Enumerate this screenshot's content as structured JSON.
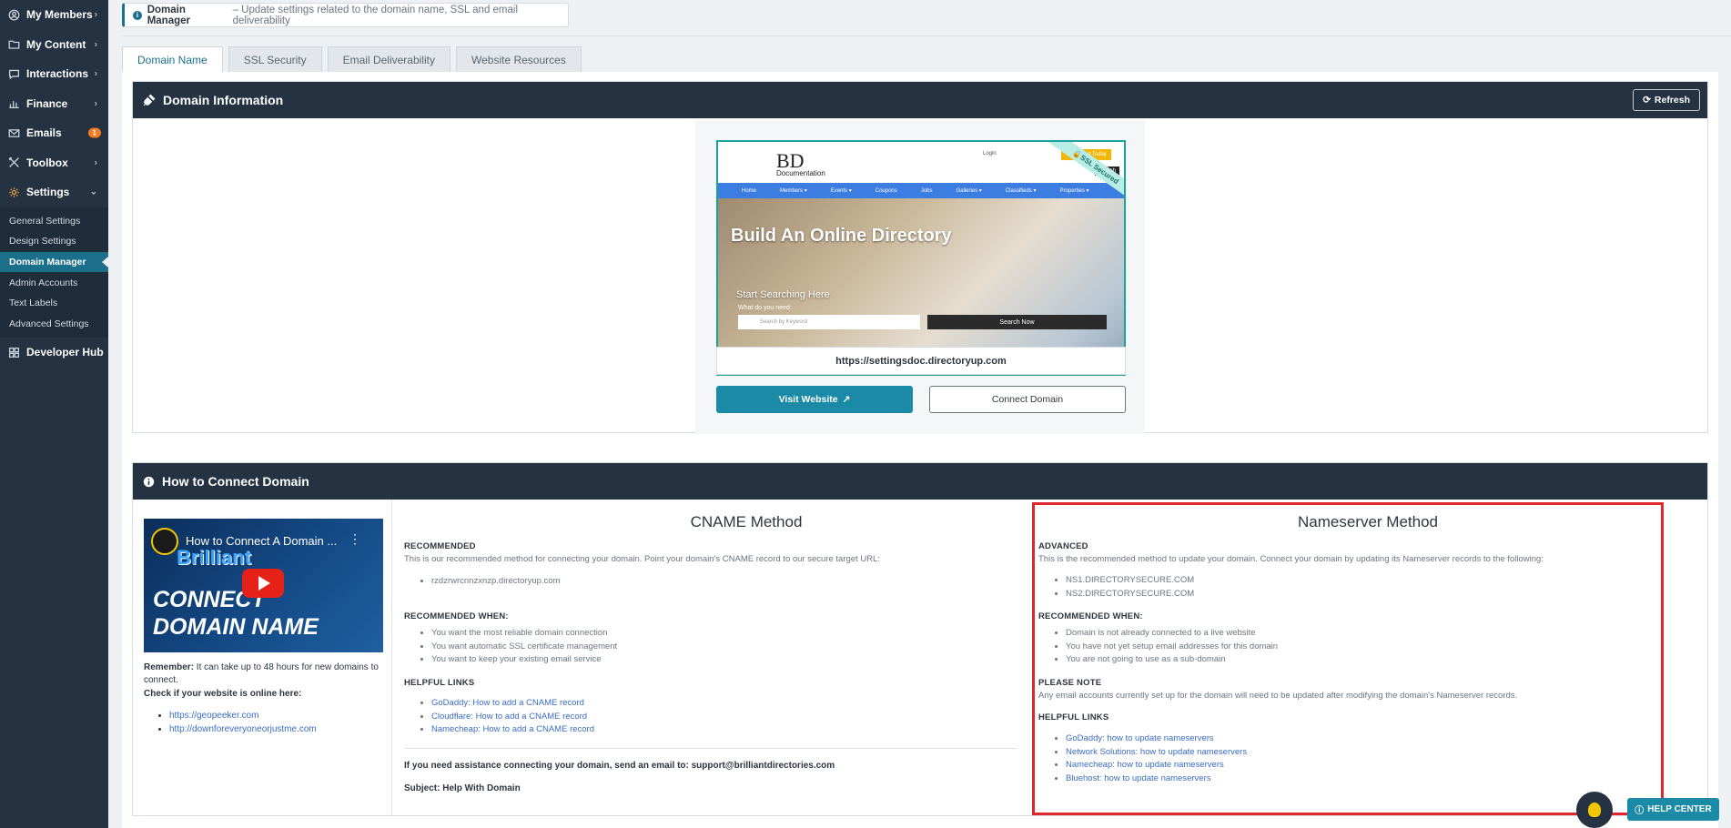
{
  "sidebar": {
    "items": [
      {
        "label": "My Members",
        "icon": "user-circle-icon"
      },
      {
        "label": "My Content",
        "icon": "folder-icon"
      },
      {
        "label": "Interactions",
        "icon": "chat-icon"
      },
      {
        "label": "Finance",
        "icon": "bar-chart-icon"
      },
      {
        "label": "Emails",
        "icon": "mail-icon",
        "badge": "1"
      },
      {
        "label": "Toolbox",
        "icon": "tools-icon"
      },
      {
        "label": "Settings",
        "icon": "gear-icon"
      }
    ],
    "settings_submenu": [
      "General Settings",
      "Design Settings",
      "Domain Manager",
      "Admin Accounts",
      "Text Labels",
      "Advanced Settings"
    ],
    "developer_hub": "Developer Hub"
  },
  "notice": {
    "title": "Domain Manager",
    "desc": "– Update settings related to the domain name, SSL and email deliverability"
  },
  "tabs": [
    "Domain Name",
    "SSL Security",
    "Email Deliverability",
    "Website Resources"
  ],
  "domain_info": {
    "header": "Domain Information",
    "refresh_label": "Refresh",
    "preview": {
      "logo": "BD",
      "logo_sub": "Documentation",
      "login": "Login",
      "add_listing": "Get Listed Today",
      "search_small": "Search",
      "nav": [
        "Home",
        "Members ▾",
        "Events ▾",
        "Coupons",
        "Jobs",
        "Galleries ▾",
        "Classifieds ▾",
        "Properties ▾"
      ],
      "hero_title": "Build An Online Directory",
      "hero_start": "Start Searching Here",
      "hero_need": "What do you need:",
      "search_placeholder": "Search by Keyword",
      "search_now": "Search Now",
      "ssl": "SSL Secured"
    },
    "url": "https://settingsdoc.directoryup.com",
    "visit_label": "Visit Website",
    "connect_label": "Connect Domain"
  },
  "how_to": {
    "header": "How to Connect Domain",
    "video_title": "How to Connect A Domain ...",
    "video_brand": "Brilliant",
    "video_line1": "CONNECT",
    "video_line2": "DOMAIN NAME",
    "remember_bold": "Remember:",
    "remember_text": " It can take up to 48 hours for new domains to connect.",
    "check_label": "Check if your website is online here:",
    "check_links": [
      "https://geopeeker.com",
      "http://downforeveryoneorjustme.com"
    ],
    "cname": {
      "title": "CNAME Method",
      "recommended_label": "RECOMMENDED",
      "recommended_text": "This is our recommended method for connecting your domain. Point your domain's CNAME record to our secure target URL:",
      "target": "rzdzrwrcnnzxnzp.directoryup.com",
      "when_label": "RECOMMENDED WHEN:",
      "when_items": [
        "You want the most reliable domain connection",
        "You want automatic SSL certificate management",
        "You want to keep your existing email service"
      ],
      "links_label": "HELPFUL LINKS",
      "links": [
        "GoDaddy: How to add a CNAME record",
        "Cloudflare: How to add a CNAME record",
        "Namecheap: How to add a CNAME record"
      ],
      "assist": "If you need assistance connecting your domain, send an email to: support@brilliantdirectories.com",
      "subject": "Subject: Help With Domain"
    },
    "ns": {
      "title": "Nameserver Method",
      "advanced_label": "ADVANCED",
      "advanced_text": "This is the recommended method to update your domain. Connect your domain by updating its Nameserver records to the following:",
      "servers": [
        "NS1.DIRECTORYSECURE.COM",
        "NS2.DIRECTORYSECURE.COM"
      ],
      "when_label": "RECOMMENDED WHEN:",
      "when_items": [
        "Domain is not already connected to a live website",
        "You have not yet setup email addresses for this domain",
        "You are not going to use as a sub-domain"
      ],
      "note_label": "PLEASE NOTE",
      "note_text": "Any email accounts currently set up for the domain will need to be updated after modifying the domain's Nameserver records.",
      "links_label": "HELPFUL LINKS",
      "links": [
        "GoDaddy: how to update nameservers",
        "Network Solutions: how to update nameservers",
        "Namecheap: how to update nameservers",
        "Bluehost: how to update nameservers"
      ]
    }
  },
  "help_center": "HELP CENTER",
  "colors": {
    "sidebar": "#243241",
    "accent": "#1b8aa6",
    "highlight": "#e0262f"
  }
}
